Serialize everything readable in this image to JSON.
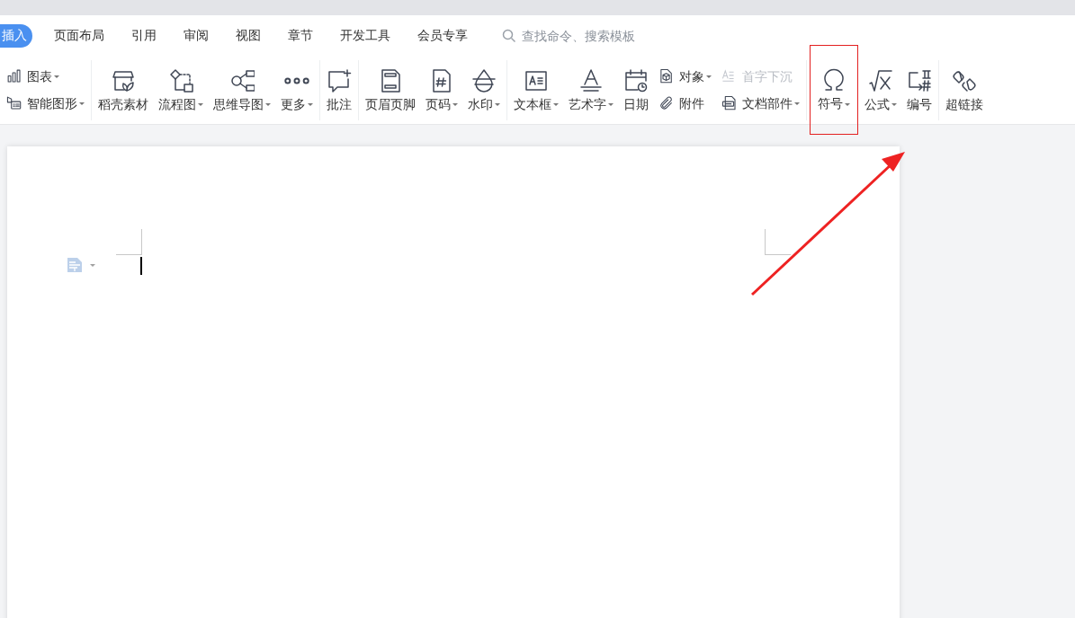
{
  "tabs": [
    {
      "label": "插入",
      "selected": true
    },
    {
      "label": "页面布局",
      "selected": false
    },
    {
      "label": "引用",
      "selected": false
    },
    {
      "label": "审阅",
      "selected": false
    },
    {
      "label": "视图",
      "selected": false
    },
    {
      "label": "章节",
      "selected": false
    },
    {
      "label": "开发工具",
      "selected": false
    },
    {
      "label": "会员专享",
      "selected": false
    }
  ],
  "search": {
    "placeholder": "查找命令、搜索模板"
  },
  "toolbar_groups": [
    {
      "items": [
        {
          "kind": "stack",
          "rows": [
            {
              "label": "图表",
              "dropdown": true,
              "disabled": false
            },
            {
              "label": "智能图形",
              "dropdown": true,
              "disabled": false
            }
          ]
        }
      ]
    },
    {
      "items": [
        {
          "kind": "large",
          "label": "稻壳素材",
          "dropdown": false,
          "highlighted": false
        },
        {
          "kind": "large",
          "label": "流程图",
          "dropdown": true,
          "highlighted": false
        },
        {
          "kind": "large",
          "label": "思维导图",
          "dropdown": true,
          "highlighted": false
        },
        {
          "kind": "large",
          "label": "更多",
          "dropdown": true,
          "highlighted": false
        }
      ]
    },
    {
      "items": [
        {
          "kind": "large",
          "label": "批注",
          "dropdown": false,
          "highlighted": false
        }
      ]
    },
    {
      "items": [
        {
          "kind": "large",
          "label": "页眉页脚",
          "dropdown": false,
          "highlighted": false
        },
        {
          "kind": "large",
          "label": "页码",
          "dropdown": true,
          "highlighted": false
        },
        {
          "kind": "large",
          "label": "水印",
          "dropdown": true,
          "highlighted": false
        }
      ]
    },
    {
      "items": [
        {
          "kind": "large",
          "label": "文本框",
          "dropdown": true,
          "highlighted": false
        },
        {
          "kind": "large",
          "label": "艺术字",
          "dropdown": true,
          "highlighted": false
        },
        {
          "kind": "large",
          "label": "日期",
          "dropdown": false,
          "highlighted": false
        },
        {
          "kind": "stack",
          "rows": [
            {
              "label": "对象",
              "dropdown": true,
              "disabled": false
            },
            {
              "label": "附件",
              "dropdown": false,
              "disabled": false
            }
          ]
        },
        {
          "kind": "stack",
          "rows": [
            {
              "label": "首字下沉",
              "dropdown": false,
              "disabled": true
            },
            {
              "label": "文档部件",
              "dropdown": true,
              "disabled": false
            }
          ]
        }
      ]
    },
    {
      "items": [
        {
          "kind": "large",
          "label": "符号",
          "dropdown": true,
          "highlighted": true
        },
        {
          "kind": "large",
          "label": "公式",
          "dropdown": true,
          "highlighted": false
        },
        {
          "kind": "large",
          "label": "编号",
          "dropdown": false,
          "highlighted": false
        }
      ]
    },
    {
      "items": [
        {
          "kind": "large",
          "label": "超链接",
          "dropdown": false,
          "highlighted": false
        }
      ]
    }
  ],
  "annotation": {
    "kind": "arrow"
  }
}
